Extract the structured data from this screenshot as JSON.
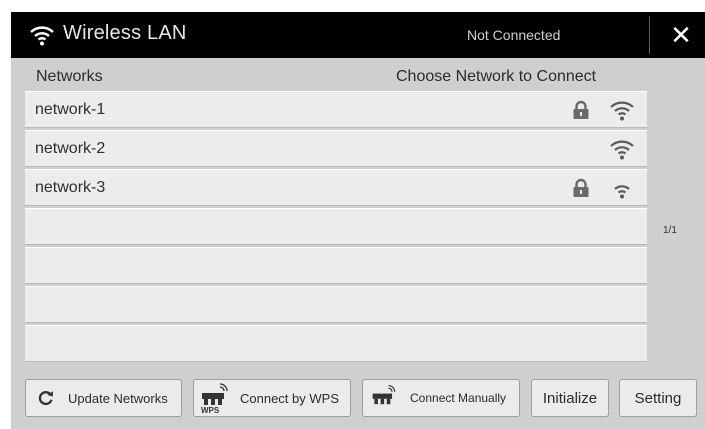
{
  "window": {
    "title": "Wireless LAN",
    "status": "Not Connected",
    "close_label": "✕"
  },
  "headers": {
    "left": "Networks",
    "right": "Choose Network to Connect"
  },
  "networks": [
    {
      "label": "network-1",
      "locked": true,
      "signal": "strong"
    },
    {
      "label": "network-2",
      "locked": false,
      "signal": "strong"
    },
    {
      "label": "network-3",
      "locked": true,
      "signal": "medium"
    },
    {
      "label": ""
    },
    {
      "label": ""
    },
    {
      "label": ""
    },
    {
      "label": ""
    }
  ],
  "pagination": "1/1",
  "buttons": {
    "update": "Update Networks",
    "wps": "Connect by WPS",
    "wps_badge": "WPS",
    "manual": "Connect Manually",
    "initialize": "Initialize",
    "setting": "Setting"
  },
  "colors": {
    "titlebar": "#000000",
    "background": "#cfcfcf",
    "row": "#ececec"
  }
}
